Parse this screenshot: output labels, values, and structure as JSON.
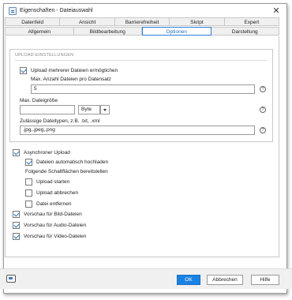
{
  "window": {
    "title": "Eigenschaften - Dateiauswahl",
    "close_glyph": "✕"
  },
  "tabs": {
    "row1": [
      "Datenfeld",
      "Ansicht",
      "Barrierefreiheit",
      "Skript",
      "Expert"
    ],
    "row2": [
      "Allgemein",
      "Bildbearbeitung",
      "Optionen",
      "Darstellung"
    ],
    "active": "Optionen"
  },
  "upload_group": {
    "title": "UPLOAD-EINSTELLUNGEN",
    "multi_upload_label": "Upload mehrerer Dateien ermöglichen",
    "multi_upload_checked": true,
    "max_files_label": "Max. Anzahl Dateien pro Datensatz",
    "max_files_value": "5",
    "max_size_label": "Max. Dateigröße",
    "max_size_value": "",
    "max_size_unit": "Byte",
    "file_types_label": "Zulässige Dateitypen, z.B. .txt, .xml",
    "file_types_value": ".jpg,.jpeg,.png",
    "help_glyph": "?"
  },
  "options": {
    "async_upload": {
      "label": "Asynchroner Upload",
      "checked": true
    },
    "auto_upload": {
      "label": "Dateien automatisch hochladen",
      "checked": true
    },
    "buttons_label": "Folgende Schaltflächen bereitstellen",
    "start_upload": {
      "label": "Upload starten",
      "checked": false
    },
    "cancel_upload": {
      "label": "Upload abbrechen",
      "checked": false
    },
    "remove_file": {
      "label": "Datei entfernen",
      "checked": false
    },
    "preview_image": {
      "label": "Vorschau für Bild-Dateien",
      "checked": true
    },
    "preview_audio": {
      "label": "Vorschau für Audio-Dateien",
      "checked": true
    },
    "preview_video": {
      "label": "Vorschau für Video-Dateien",
      "checked": true
    }
  },
  "footer": {
    "ok": "OK",
    "cancel": "Abbrechen",
    "help": "Hilfe"
  }
}
